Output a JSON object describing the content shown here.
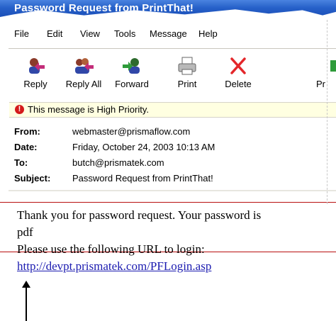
{
  "window": {
    "title": "Password Request from PrintThat!"
  },
  "menu": {
    "items": [
      "File",
      "Edit",
      "View",
      "Tools",
      "Message",
      "Help"
    ]
  },
  "toolbar": {
    "buttons": [
      {
        "label": "Reply",
        "icon": "reply-icon"
      },
      {
        "label": "Reply All",
        "icon": "reply-all-icon"
      },
      {
        "label": "Forward",
        "icon": "forward-icon"
      },
      {
        "label": "Print",
        "icon": "printer-icon"
      },
      {
        "label": "Delete",
        "icon": "delete-x-icon"
      },
      {
        "label": "Pr",
        "icon": "previous-icon"
      }
    ]
  },
  "priority_bar": {
    "text": "This message is High Priority.",
    "icon": "exclamation-icon",
    "color": "#d41a1a"
  },
  "headers": {
    "from_label": "From:",
    "from_value": "webmaster@prismaflow.com",
    "date_label": "Date:",
    "date_value": "Friday, October 24, 2003 10:13 AM",
    "to_label": "To:",
    "to_value": "butch@prismatek.com",
    "subject_label": "Subject:",
    "subject_value": "Password Request from PrintThat!"
  },
  "message": {
    "line1": "Thank you for password request.  Your password is",
    "line2": "pdf",
    "line3": "Please use the following URL to login:",
    "link": "http://devpt.prismatek.com/PFLogin.asp"
  },
  "colors": {
    "titlebar": "#2761c9",
    "highlight_lines": "#b80f0f",
    "link": "#1b1bb0",
    "priority_bg": "#ffffe1"
  }
}
